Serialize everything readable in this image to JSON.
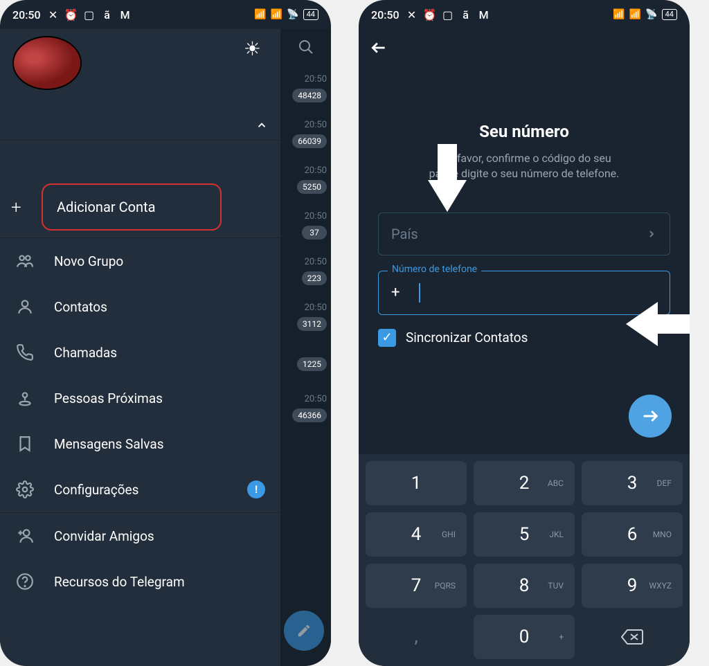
{
  "status": {
    "time": "20:50",
    "battery": "44"
  },
  "left": {
    "add_account": "Adicionar Conta",
    "menu": [
      {
        "key": "novo-grupo",
        "label": "Novo Grupo"
      },
      {
        "key": "contatos",
        "label": "Contatos"
      },
      {
        "key": "chamadas",
        "label": "Chamadas"
      },
      {
        "key": "pessoas-proximas",
        "label": "Pessoas Próximas"
      },
      {
        "key": "mensagens-salvas",
        "label": "Mensagens Salvas"
      },
      {
        "key": "configuracoes",
        "label": "Configurações",
        "badge": "!"
      },
      {
        "key": "convidar-amigos",
        "label": "Convidar Amigos"
      },
      {
        "key": "recursos-telegram",
        "label": "Recursos do Telegram"
      }
    ],
    "chats": [
      {
        "time": "20:50",
        "badge": "48428"
      },
      {
        "time": "20:50",
        "badge": "66039"
      },
      {
        "time": "20:50",
        "badge": "5250"
      },
      {
        "time": "20:50",
        "badge": "37"
      },
      {
        "time": "20:50",
        "badge": "223"
      },
      {
        "time": "20:50",
        "badge": "3112"
      },
      {
        "time": "",
        "badge": "1225"
      },
      {
        "time": "20:50",
        "badge": "46366"
      }
    ]
  },
  "right": {
    "title": "Seu número",
    "subtitle": "Por favor, confirme o código do seu país e digite o seu número de telefone.",
    "country_placeholder": "País",
    "phone_legend": "Número de telefone",
    "phone_prefix": "+",
    "sync_label": "Sincronizar Contatos",
    "keypad": [
      {
        "n": "1",
        "l": ""
      },
      {
        "n": "2",
        "l": "ABC"
      },
      {
        "n": "3",
        "l": "DEF"
      },
      {
        "n": "4",
        "l": "GHI"
      },
      {
        "n": "5",
        "l": "JKL"
      },
      {
        "n": "6",
        "l": "MNO"
      },
      {
        "n": "7",
        "l": "PQRS"
      },
      {
        "n": "8",
        "l": "TUV"
      },
      {
        "n": "9",
        "l": "WXYZ"
      },
      {
        "n": ",",
        "l": "",
        "flat": true
      },
      {
        "n": "0",
        "l": "+"
      },
      {
        "n": "⌫",
        "l": "",
        "flat": true
      }
    ]
  }
}
